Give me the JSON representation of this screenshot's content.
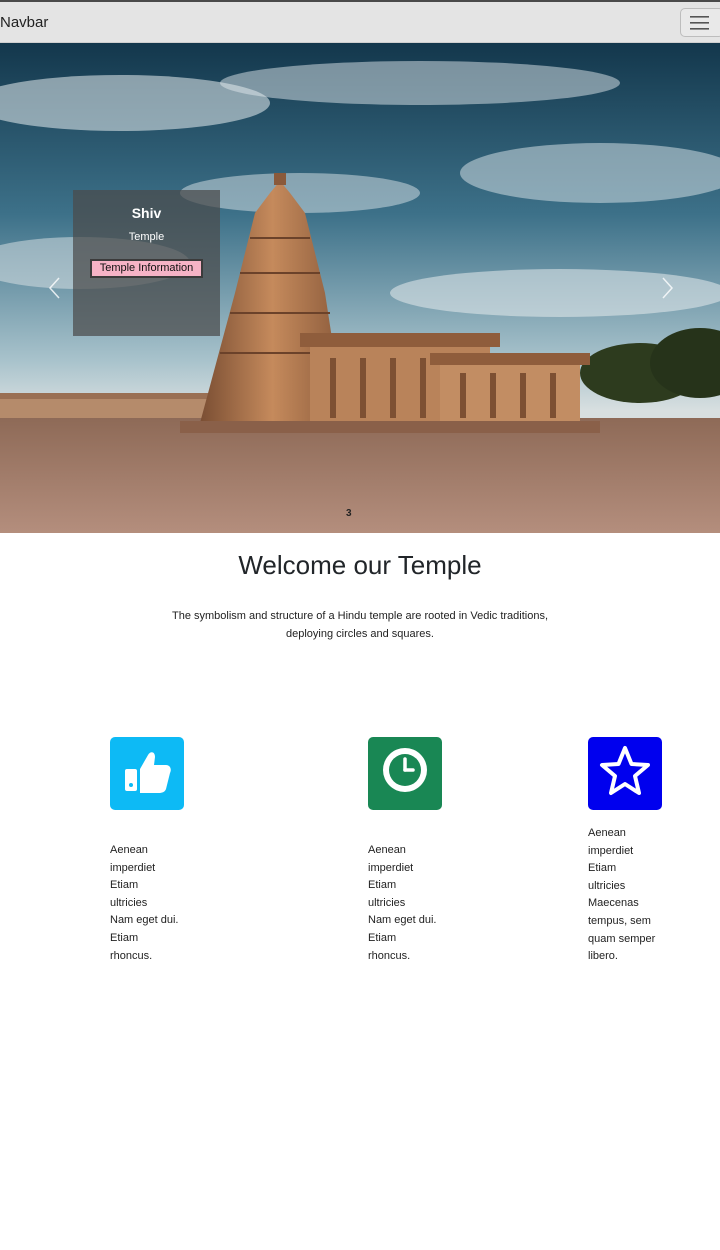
{
  "navbar": {
    "brand": "Navbar",
    "toggler_icon": "hamburger-menu-icon"
  },
  "carousel": {
    "caption_title": "Shiv",
    "caption_subtitle": "Temple",
    "caption_button": "Temple Information",
    "prev_icon": "chevron-left-icon",
    "next_icon": "chevron-right-icon",
    "indicator": "3"
  },
  "welcome": {
    "title": "Welcome our Temple",
    "intro_line1": "The symbolism and structure of a Hindu temple are rooted in Vedic traditions,",
    "intro_line2": "deploying circles and squares."
  },
  "features": [
    {
      "icon": "thumbs-up-icon",
      "color": "#0dbaf5",
      "lines": [
        "Aenean",
        "imperdiet",
        "Etiam",
        "ultricies",
        "Nam eget dui.",
        "Etiam",
        "rhoncus."
      ]
    },
    {
      "icon": "clock-icon",
      "color": "#198754",
      "lines": [
        "Aenean",
        "imperdiet",
        "Etiam",
        "ultricies",
        "Nam eget dui.",
        "Etiam",
        "rhoncus."
      ]
    },
    {
      "icon": "star-icon",
      "color": "#0000ee",
      "lines": [
        "Aenean",
        "imperdiet",
        "Etiam",
        "ultricies",
        "Maecenas",
        "tempus, sem",
        "quam semper",
        "libero."
      ]
    }
  ]
}
